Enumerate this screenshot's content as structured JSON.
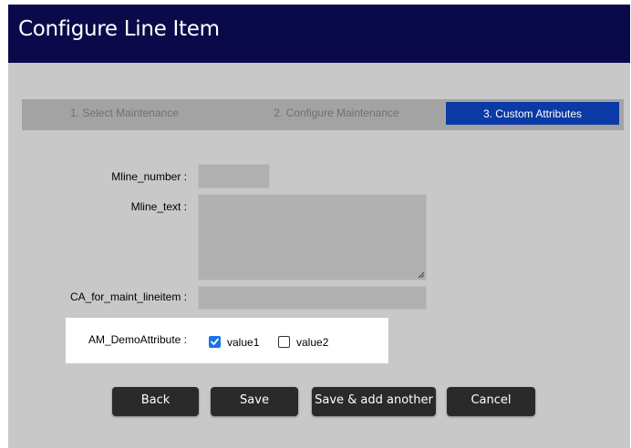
{
  "window": {
    "title": "Configure Line Item"
  },
  "steps": [
    {
      "label": "1. Select Maintenance",
      "active": false
    },
    {
      "label": "2. Configure Maintenance",
      "active": false
    },
    {
      "label": "3. Custom Attributes",
      "active": true
    }
  ],
  "form": {
    "mline_number": {
      "label": "Mline_number :",
      "value": ""
    },
    "mline_text": {
      "label": "Mline_text :",
      "value": ""
    },
    "ca_for_maint_lineitem": {
      "label": "CA_for_maint_lineitem :",
      "value": ""
    },
    "am_demo_attribute": {
      "label": "AM_DemoAttribute :",
      "options": [
        {
          "label": "value1",
          "checked": true
        },
        {
          "label": "value2",
          "checked": false
        }
      ]
    }
  },
  "buttons": {
    "back": "Back",
    "save": "Save",
    "save_add_another": "Save & add another",
    "cancel": "Cancel"
  },
  "colors": {
    "titlebar": "#0a0a4a",
    "active_step": "#0b3aa6",
    "checkbox_checked": "#1a73e8",
    "button": "#2a2a2a"
  }
}
